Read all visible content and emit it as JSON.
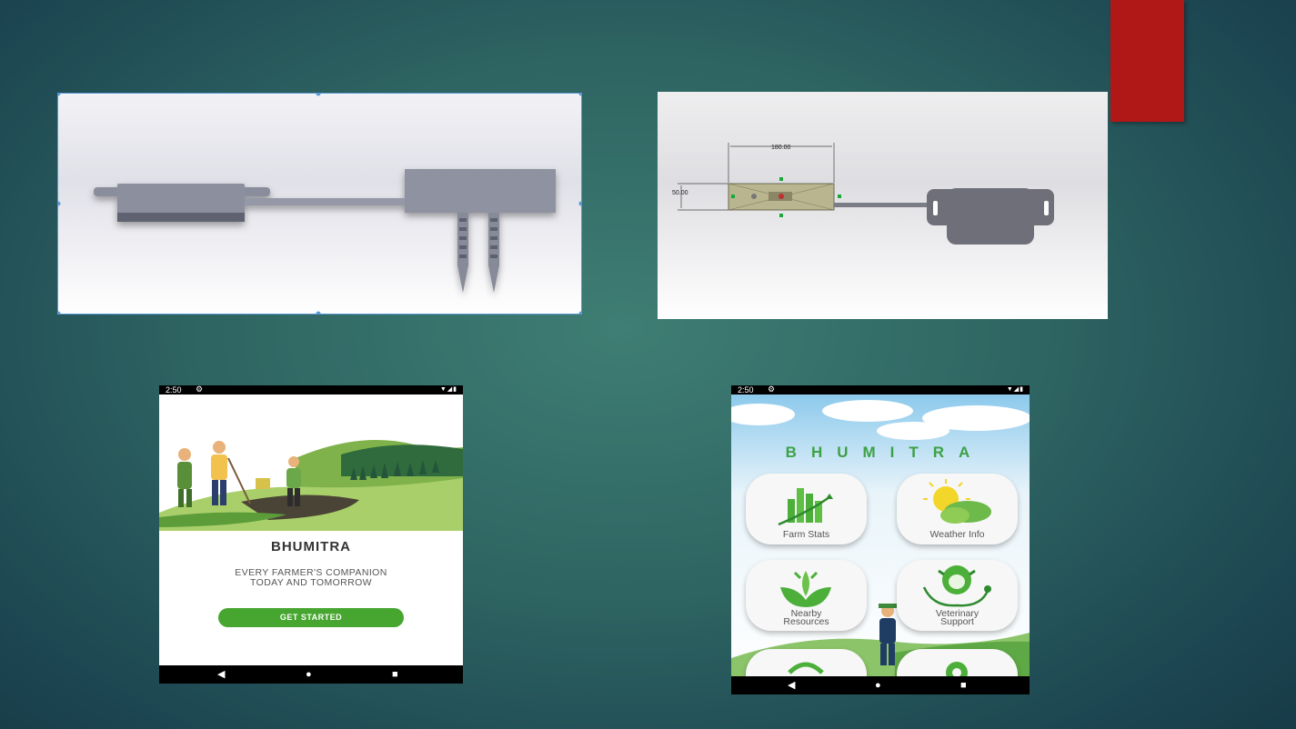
{
  "slide": {
    "accent_color": "#b01818",
    "background_color": "#2d6361"
  },
  "cad_top": {
    "description_icon": "soil-sensor-3d-model"
  },
  "cad_side": {
    "dim_width": "180.00",
    "dim_height": "50.00"
  },
  "phone_welcome": {
    "status_time": "2:50",
    "app_name": "BHUMITRA",
    "tagline_line1": "EVERY FARMER'S COMPANION",
    "tagline_line2": "TODAY AND TOMORROW",
    "cta_label": "GET STARTED",
    "cta_color": "#46a62f",
    "nav": [
      "back-icon",
      "home-icon",
      "recents-icon"
    ]
  },
  "phone_dashboard": {
    "status_time": "2:50",
    "app_name": "BHUMITRA",
    "brand_color": "#3da145",
    "tiles": [
      {
        "label": "Farm Stats",
        "icon": "bar-chart-icon"
      },
      {
        "label": "Weather Info",
        "icon": "sun-cloud-icon"
      },
      {
        "label_line1": "Nearby",
        "label_line2": "Resources",
        "icon": "leaf-icon"
      },
      {
        "label_line1": "Veterinary",
        "label_line2": "Support",
        "icon": "cow-stethoscope-icon"
      }
    ]
  }
}
